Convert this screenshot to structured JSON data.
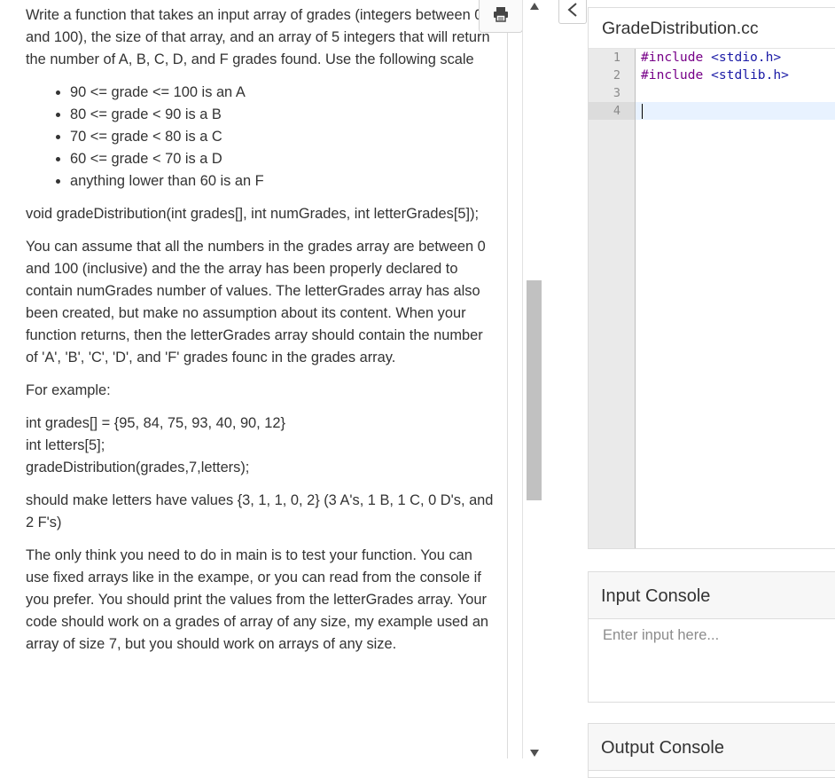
{
  "problem": {
    "intro": "Write a function that takes an input array of grades (integers between 0 and 100), the size of that array, and an array of 5 integers that will return the number of A, B, C, D, and F grades found. Use the following scale",
    "scale": [
      "90 <= grade <= 100 is an A",
      "80 <= grade < 90 is a B",
      "70 <= grade < 80 is a C",
      "60 <= grade < 70 is a D",
      "anything lower than 60 is an F"
    ],
    "signature": "void gradeDistribution(int grades[], int numGrades, int letterGrades[5]);",
    "assumption": "You can assume that all the numbers in the grades array are between 0 and 100 (inclusive) and the the array has been properly declared to contain numGrades number of values. The letterGrades array has also been created, but make no assumption about its content. When your function returns, then the letterGrades array should contain the number of 'A', 'B', 'C', 'D', and 'F' grades founc in the grades array.",
    "example_label": "For example:",
    "example_code": [
      "int grades[] = {95, 84, 75, 93, 40, 90, 12}",
      "int letters[5];",
      "gradeDistribution(grades,7,letters);"
    ],
    "result": "should make letters have values {3, 1, 1, 0, 2} (3 A's, 1 B, 1 C, 0 D's, and 2 F's)",
    "main_note": "The only think you need to do in main is to test your function. You can use fixed arrays like in the exampe, or you can read from the console if you prefer. You should print the values from the letterGrades array. Your code should work on a grades of array of any size, my example used an array of size 7, but you should work on arrays of any size."
  },
  "editor": {
    "filename": "GradeDistribution.cc",
    "lines": [
      {
        "num": "1",
        "directive": "#include",
        "target": " <stdio.h>"
      },
      {
        "num": "2",
        "directive": "#include",
        "target": " <stdlib.h>"
      },
      {
        "num": "3",
        "directive": "",
        "target": ""
      },
      {
        "num": "4",
        "directive": "",
        "target": ""
      }
    ]
  },
  "input_console": {
    "title": "Input Console",
    "placeholder": "Enter input here..."
  },
  "output_console": {
    "title": "Output Console"
  },
  "icons": {
    "print": "printer-icon",
    "collapse": "chevron-left-icon",
    "scroll_up": "scroll-up-arrow-icon",
    "scroll_down": "scroll-down-arrow-icon"
  }
}
